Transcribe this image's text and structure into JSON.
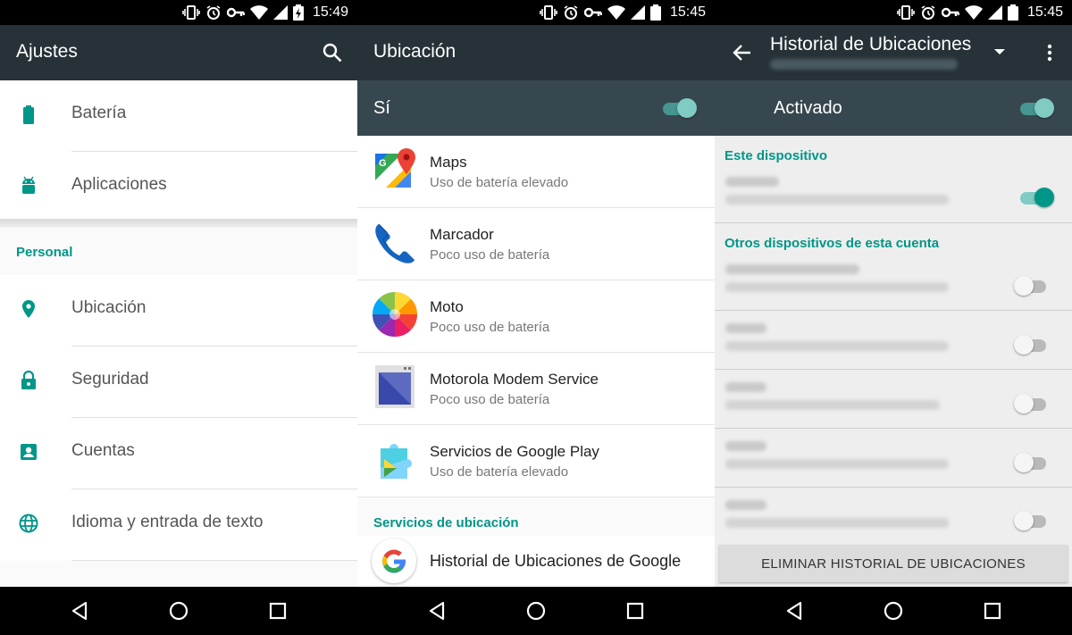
{
  "status": {
    "time1": "15:49",
    "time2": "15:45",
    "time3": "15:45"
  },
  "settings": {
    "title": "Ajustes",
    "items_top": [
      {
        "label": "Batería",
        "icon": "battery-icon"
      },
      {
        "label": "Aplicaciones",
        "icon": "android-icon"
      }
    ],
    "section": "Personal",
    "items_personal": [
      {
        "label": "Ubicación",
        "icon": "location-pin-icon"
      },
      {
        "label": "Seguridad",
        "icon": "lock-icon"
      },
      {
        "label": "Cuentas",
        "icon": "account-icon"
      },
      {
        "label": "Idioma y entrada de texto",
        "icon": "globe-icon"
      }
    ]
  },
  "location": {
    "title": "Ubicación",
    "switch_label": "Sí",
    "switch_on": true,
    "apps": [
      {
        "name": "Maps",
        "sub": "Uso de batería elevado",
        "icon": "maps-icon"
      },
      {
        "name": "Marcador",
        "sub": "Poco uso de batería",
        "icon": "phone-icon"
      },
      {
        "name": "Moto",
        "sub": "Poco uso de batería",
        "icon": "moto-icon"
      },
      {
        "name": "Motorola Modem Service",
        "sub": "Poco uso de batería",
        "icon": "modem-icon"
      },
      {
        "name": "Servicios de Google Play",
        "sub": "Uso de batería elevado",
        "icon": "play-services-icon"
      }
    ],
    "services_section": "Servicios de ubicación",
    "google_history": "Historial de Ubicaciones de Google"
  },
  "history": {
    "title": "Historial de Ubicaciones",
    "switch_label": "Activado",
    "this_device": "Este dispositivo",
    "other_devices": "Otros dispositivos de esta cuenta",
    "delete_button": "ELIMINAR HISTORIAL DE UBICACIONES",
    "device_states": [
      true,
      false,
      false,
      false,
      false,
      false
    ]
  },
  "colors": {
    "accent": "#009688",
    "appbar": "#263238",
    "switchbar": "#37474f"
  }
}
